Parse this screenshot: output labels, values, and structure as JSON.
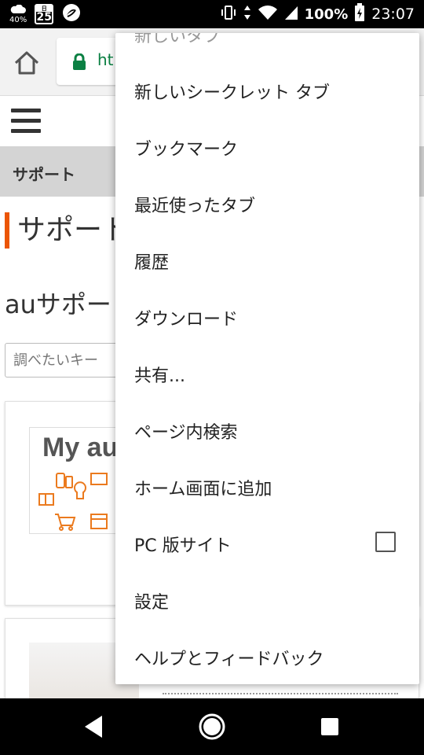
{
  "status_bar": {
    "weather": "40%",
    "calendar_day": "日",
    "calendar_date": "25",
    "battery": "100%",
    "time": "23:07"
  },
  "toolbar": {
    "url": "ht",
    "home_icon": "home-icon",
    "lock_icon": "lock-icon"
  },
  "page": {
    "breadcrumb": "サポート",
    "title": "サポート",
    "au_title": "auサポート",
    "search_placeholder": "調べたいキー",
    "myau_banner_text": "My au"
  },
  "menu": {
    "partial_item": "新しいタブ",
    "items": [
      {
        "label": "新しいシークレット タブ"
      },
      {
        "label": "ブックマーク"
      },
      {
        "label": "最近使ったタブ"
      },
      {
        "label": "履歴"
      },
      {
        "label": "ダウンロード"
      },
      {
        "label": "共有..."
      },
      {
        "label": "ページ内検索"
      },
      {
        "label": "ホーム画面に追加"
      },
      {
        "label": "PC 版サイト",
        "checkbox": false
      },
      {
        "label": "設定"
      },
      {
        "label": "ヘルプとフィードバック"
      }
    ]
  },
  "colors": {
    "accent": "#eb5505",
    "secure": "#0b8043"
  }
}
